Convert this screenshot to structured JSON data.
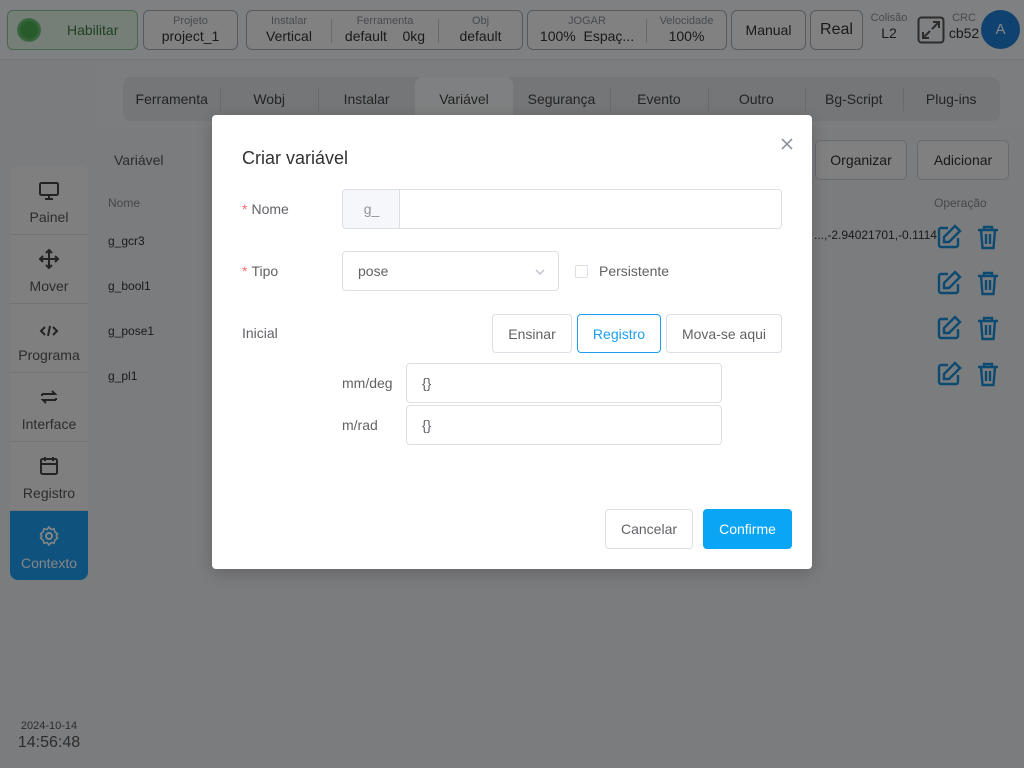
{
  "topbar": {
    "enable_label": "Habilitar",
    "project": {
      "label": "Projeto",
      "value": "project_1"
    },
    "install": {
      "label": "Instalar",
      "value": "Vertical"
    },
    "tool": {
      "label": "Ferramenta",
      "value": "default",
      "extra": "0kg"
    },
    "obj": {
      "label": "Obj",
      "value": "default"
    },
    "jog": {
      "label": "JOGAR",
      "value": "100%",
      "extra": "Espaç..."
    },
    "speed": {
      "label": "Velocidade",
      "value": "100%"
    },
    "mode": "Manual",
    "real": "Real",
    "collision": {
      "label": "Colisão",
      "value": "L2"
    },
    "crc": {
      "label": "CRC",
      "value": "cb52"
    },
    "avatar": "A"
  },
  "sidebar": {
    "items": [
      {
        "label": "Painel",
        "icon": "monitor-icon"
      },
      {
        "label": "Mover",
        "icon": "move-icon"
      },
      {
        "label": "Programa",
        "icon": "code-icon"
      },
      {
        "label": "Interface",
        "icon": "swap-icon"
      },
      {
        "label": "Registro",
        "icon": "calendar-icon"
      },
      {
        "label": "Contexto",
        "icon": "gear-icon",
        "active": true
      }
    ],
    "date": "2024-10-14",
    "time": "14:56:48"
  },
  "tabs": [
    "Ferramenta",
    "Wobj",
    "Instalar",
    "Variável",
    "Segurança",
    "Evento",
    "Outro",
    "Bg-Script",
    "Plug-ins"
  ],
  "panel": {
    "title": "Variável",
    "organize_label": "Organizar",
    "add_label": "Adicionar",
    "col_name": "Nome",
    "col_op": "Operação",
    "rows": [
      {
        "name": "g_gcr3",
        "value": "...,-2.94021701,-0.1114"
      },
      {
        "name": "g_bool1",
        "value": ""
      },
      {
        "name": "g_pose1",
        "value": ""
      },
      {
        "name": "g_pl1",
        "value": ""
      }
    ]
  },
  "modal": {
    "title": "Criar variável",
    "name_label": "Nome",
    "name_prefix": "g_",
    "name_value": "",
    "type_label": "Tipo",
    "type_value": "pose",
    "persistent_label": "Persistente",
    "initial_label": "Inicial",
    "teach_label": "Ensinar",
    "record_label": "Registro",
    "move_here_label": "Mova-se aqui",
    "unit1_label": "mm/deg",
    "unit1_value": "{}",
    "unit2_label": "m/rad",
    "unit2_value": "{}",
    "cancel_label": "Cancelar",
    "confirm_label": "Confirme"
  },
  "colors": {
    "accent": "#1e9ef0",
    "confirm": "#0aa5f5",
    "required": "#f56c6c",
    "enable_green": "#4caf50"
  }
}
